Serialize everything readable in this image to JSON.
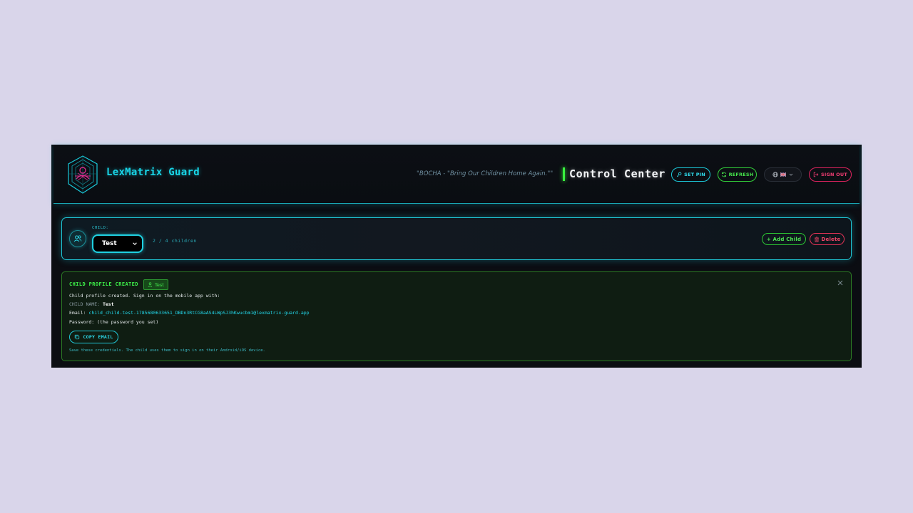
{
  "header": {
    "brand": "LexMatrix Guard",
    "tagline": "\"BOCHA - \"Bring Our Children Home Again.\"\"",
    "title": "Control Center",
    "buttons": {
      "set_pin": "SET PIN",
      "refresh": "REFRESH",
      "sign_out": "SIGN OUT"
    },
    "language": {
      "flag": "uk-flag",
      "icon": "globe-icon"
    }
  },
  "child_bar": {
    "label": "CHILD:",
    "selected_child": "Test",
    "count": "2 / 4 children",
    "add_label": "+ Add Child",
    "delete_label": "Delete"
  },
  "notice": {
    "title": "CHILD PROFILE CREATED",
    "badge": "Test",
    "intro": "Child profile created. Sign in on the mobile app with:",
    "name_label": "CHILD NAME:",
    "name_value": "Test",
    "email_label": "Email:",
    "email_value": "child_child-test-1785680633651_DBDn3RtCG8aAS4LWpSJ3hKwucbm1@lexmatrix-guard.app",
    "password_line": "Password: (the password you set)",
    "copy_label": "COPY EMAIL",
    "footer": "Save these credentials. The child uses them to sign in on their Android/iOS device."
  },
  "colors": {
    "accent_cyan": "#19d6e8",
    "accent_green": "#39ef3f",
    "accent_red": "#e0245f",
    "background": "#0b0d12"
  }
}
